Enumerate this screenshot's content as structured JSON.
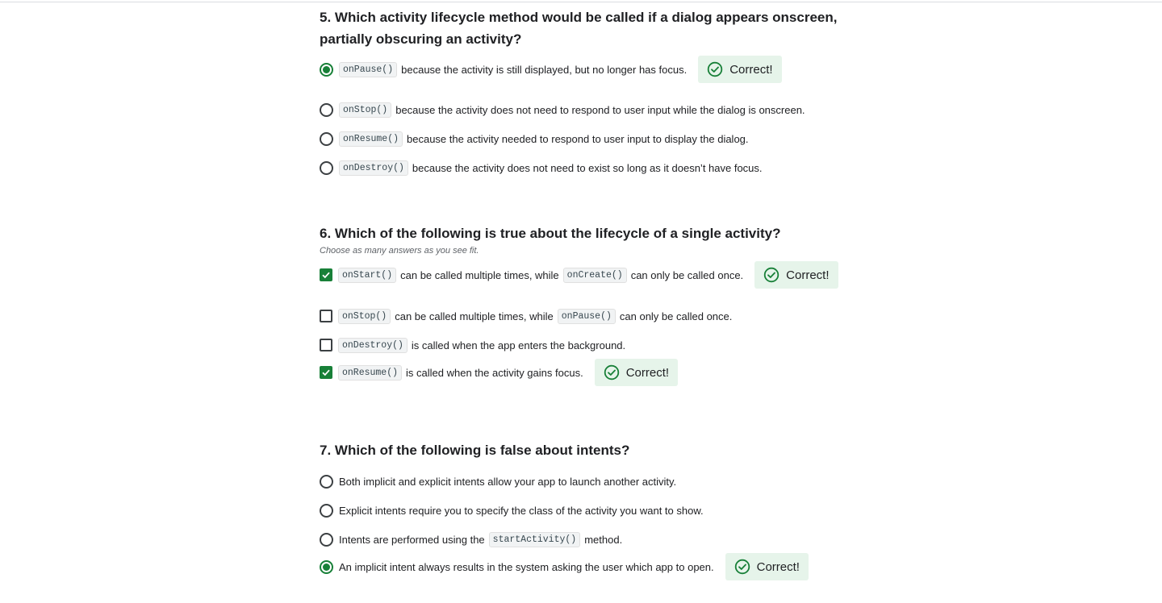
{
  "questions": [
    {
      "title_line1": "5. Which activity lifecycle method would be called if a dialog appears onscreen,",
      "title_line2": "partially obscuring an activity?",
      "options": [
        {
          "code": "onPause()",
          "text": "because the activity is still displayed, but no longer has focus.",
          "checked": true,
          "feedback": "Correct!"
        },
        {
          "code": "onStop()",
          "text": "because the activity does not need to respond to user input while the dialog is onscreen.",
          "checked": false
        },
        {
          "code": "onResume()",
          "text": "because the activity needed to respond to user input to display the dialog.",
          "checked": false
        },
        {
          "code": "onDestroy()",
          "text": "because the activity does not need to exist so long as it doesn’t have focus.",
          "checked": false
        }
      ]
    },
    {
      "title": "6. Which of the following is true about the lifecycle of a single activity?",
      "hint": "Choose as many answers as you see fit.",
      "options": [
        {
          "code": "onStart()",
          "text": "can be called multiple times, while",
          "code2": "onCreate()",
          "text2": "can only be called once.",
          "checked": true,
          "feedback": "Correct!"
        },
        {
          "code": "onStop()",
          "text": "can be called multiple times, while",
          "code2": "onPause()",
          "text2": "can only be called once.",
          "checked": false
        },
        {
          "code": "onDestroy()",
          "text": "is called when the app enters the background.",
          "checked": false
        },
        {
          "code": "onResume()",
          "text": "is called when the activity gains focus.",
          "checked": true,
          "feedback": "Correct!"
        }
      ]
    },
    {
      "title": "7. Which of the following is false about intents?",
      "options": [
        {
          "text": "Both implicit and explicit intents allow your app to launch another activity.",
          "checked": false
        },
        {
          "text": "Explicit intents require you to specify the class of the activity you want to show.",
          "checked": false
        },
        {
          "text": "Intents are performed using the",
          "code2": "startActivity()",
          "text2": "method.",
          "checked": false
        },
        {
          "text": "An implicit intent always results in the system asking the user which app to open.",
          "checked": true,
          "feedback": "Correct!"
        }
      ]
    }
  ],
  "colors": {
    "correct_green": "#188038",
    "badge_bg": "#e6f4ea"
  },
  "icons": {
    "radio": "radio-icon",
    "checkbox": "checkbox-icon",
    "correct": "check-circle-icon"
  }
}
